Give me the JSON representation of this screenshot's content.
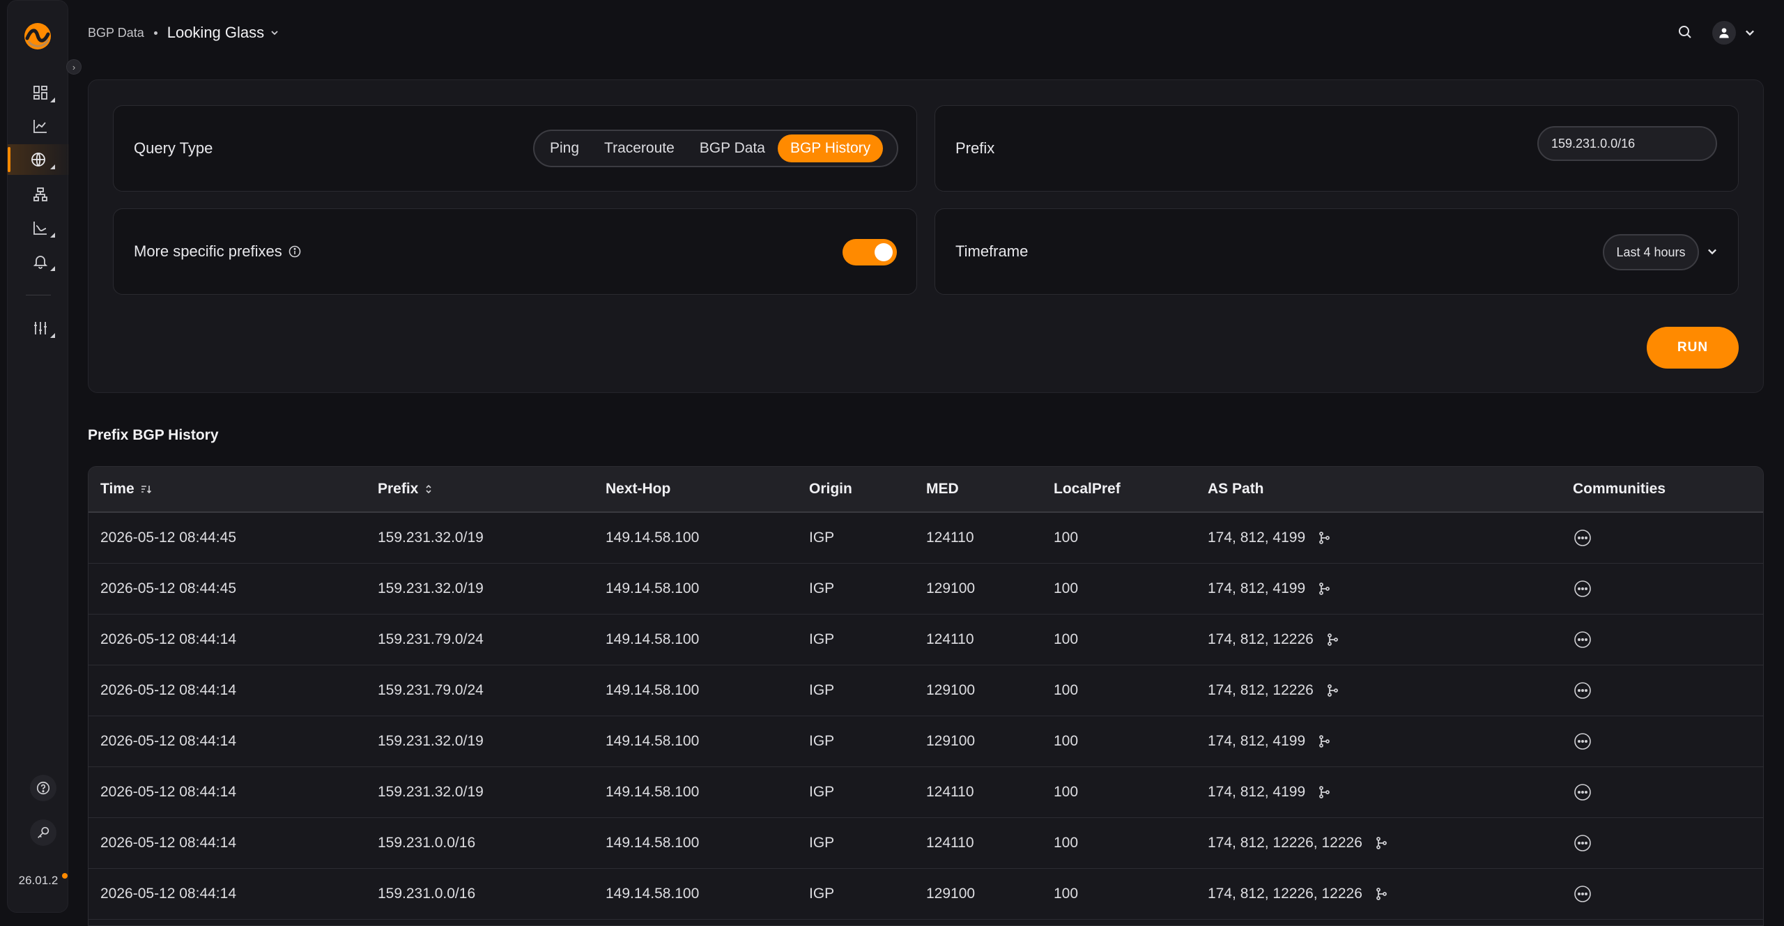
{
  "app": {
    "version": "26.01.2"
  },
  "header": {
    "breadcrumb_parent": "BGP Data",
    "breadcrumb_current": "Looking Glass"
  },
  "query": {
    "type_label": "Query Type",
    "types": [
      "Ping",
      "Traceroute",
      "BGP Data",
      "BGP History"
    ],
    "selected_type": "BGP History",
    "prefix_label": "Prefix",
    "prefix_value": "159.231.0.0/16",
    "more_specific_label": "More specific prefixes",
    "more_specific_enabled": true,
    "timeframe_label": "Timeframe",
    "timeframe_value": "Last 4 hours",
    "run_label": "RUN"
  },
  "results": {
    "title": "Prefix BGP History",
    "columns": [
      "Time",
      "Prefix",
      "Next-Hop",
      "Origin",
      "MED",
      "LocalPref",
      "AS Path",
      "Communities"
    ],
    "rows": [
      {
        "time": "2026-05-12 08:44:45",
        "prefix": "159.231.32.0/19",
        "next_hop": "149.14.58.100",
        "origin": "IGP",
        "med": "124110",
        "local_pref": "100",
        "as_path": "174, 812, 4199"
      },
      {
        "time": "2026-05-12 08:44:45",
        "prefix": "159.231.32.0/19",
        "next_hop": "149.14.58.100",
        "origin": "IGP",
        "med": "129100",
        "local_pref": "100",
        "as_path": "174, 812, 4199"
      },
      {
        "time": "2026-05-12 08:44:14",
        "prefix": "159.231.79.0/24",
        "next_hop": "149.14.58.100",
        "origin": "IGP",
        "med": "124110",
        "local_pref": "100",
        "as_path": "174, 812, 12226"
      },
      {
        "time": "2026-05-12 08:44:14",
        "prefix": "159.231.79.0/24",
        "next_hop": "149.14.58.100",
        "origin": "IGP",
        "med": "129100",
        "local_pref": "100",
        "as_path": "174, 812, 12226"
      },
      {
        "time": "2026-05-12 08:44:14",
        "prefix": "159.231.32.0/19",
        "next_hop": "149.14.58.100",
        "origin": "IGP",
        "med": "129100",
        "local_pref": "100",
        "as_path": "174, 812, 4199"
      },
      {
        "time": "2026-05-12 08:44:14",
        "prefix": "159.231.32.0/19",
        "next_hop": "149.14.58.100",
        "origin": "IGP",
        "med": "124110",
        "local_pref": "100",
        "as_path": "174, 812, 4199"
      },
      {
        "time": "2026-05-12 08:44:14",
        "prefix": "159.231.0.0/16",
        "next_hop": "149.14.58.100",
        "origin": "IGP",
        "med": "124110",
        "local_pref": "100",
        "as_path": "174, 812, 12226, 12226"
      },
      {
        "time": "2026-05-12 08:44:14",
        "prefix": "159.231.0.0/16",
        "next_hop": "149.14.58.100",
        "origin": "IGP",
        "med": "129100",
        "local_pref": "100",
        "as_path": "174, 812, 12226, 12226"
      }
    ]
  },
  "colors": {
    "accent": "#ff8a00",
    "background": "#111115",
    "panel": "#18181d",
    "card": "#121216"
  }
}
